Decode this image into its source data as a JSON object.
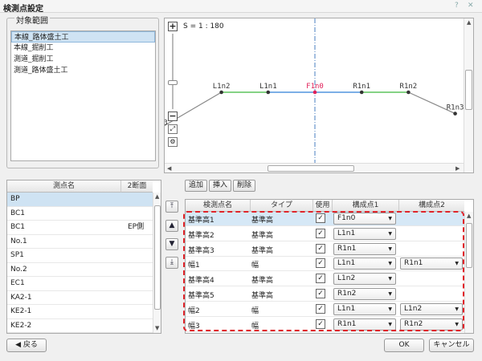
{
  "window": {
    "title": "検測点設定"
  },
  "range_group": {
    "legend": "対象範囲",
    "items": [
      "本線_路体盛土工",
      "本線_掘削工",
      "測道_掘削工",
      "測道_路体盛土工"
    ],
    "selected_index": 0
  },
  "graph": {
    "scale_label": "S = 1 : 180",
    "points": [
      {
        "label": "L1n3",
        "x": -4,
        "y": -1.2
      },
      {
        "label": "L1n2",
        "x": -2.4,
        "y": 0
      },
      {
        "label": "L1n1",
        "x": -1.2,
        "y": 0
      },
      {
        "label": "F1n0",
        "x": 0,
        "y": 0
      },
      {
        "label": "R1n1",
        "x": 1.2,
        "y": 0
      },
      {
        "label": "R1n2",
        "x": 2.4,
        "y": 0
      },
      {
        "label": "R1n3",
        "x": 3.6,
        "y": -0.7
      }
    ],
    "colors": {
      "green": "#3cb83c",
      "blue": "#2d7fd8",
      "gray": "#888888",
      "center_point": "#e0205a",
      "center_line": "#4a7fc0"
    }
  },
  "toolbar": {
    "add": "追加",
    "insert": "挿入",
    "delete": "削除"
  },
  "left_grid": {
    "headers": [
      "測点名",
      "2断面"
    ],
    "rows": [
      {
        "name": "BP",
        "sec": ""
      },
      {
        "name": "BC1",
        "sec": ""
      },
      {
        "name": "BC1",
        "sec": "EP側"
      },
      {
        "name": "No.1",
        "sec": ""
      },
      {
        "name": "SP1",
        "sec": ""
      },
      {
        "name": "No.2",
        "sec": ""
      },
      {
        "name": "EC1",
        "sec": ""
      },
      {
        "name": "KA2-1",
        "sec": ""
      },
      {
        "name": "KE2-1",
        "sec": ""
      },
      {
        "name": "KE2-2",
        "sec": ""
      }
    ]
  },
  "right_grid": {
    "headers": [
      "検測点名",
      "タイプ",
      "使用",
      "構成点1",
      "構成点2"
    ],
    "rows": [
      {
        "name": "基準高1",
        "type": "基準高",
        "use": "✓",
        "p1": "F1n0",
        "p2": ""
      },
      {
        "name": "基準高2",
        "type": "基準高",
        "use": "✓",
        "p1": "L1n1",
        "p2": ""
      },
      {
        "name": "基準高3",
        "type": "基準高",
        "use": "✓",
        "p1": "R1n1",
        "p2": ""
      },
      {
        "name": "幅1",
        "type": "幅",
        "use": "✓",
        "p1": "L1n1",
        "p2": "R1n1"
      },
      {
        "name": "基準高4",
        "type": "基準高",
        "use": "✓",
        "p1": "L1n2",
        "p2": ""
      },
      {
        "name": "基準高5",
        "type": "基準高",
        "use": "✓",
        "p1": "R1n2",
        "p2": ""
      },
      {
        "name": "幅2",
        "type": "幅",
        "use": "✓",
        "p1": "L1n1",
        "p2": "L1n2"
      },
      {
        "name": "幅3",
        "type": "幅",
        "use": "✓",
        "p1": "R1n1",
        "p2": "R1n2"
      }
    ]
  },
  "bottom": {
    "back": "◀ 戻る",
    "ok": "OK",
    "cancel": "キャンセル"
  }
}
